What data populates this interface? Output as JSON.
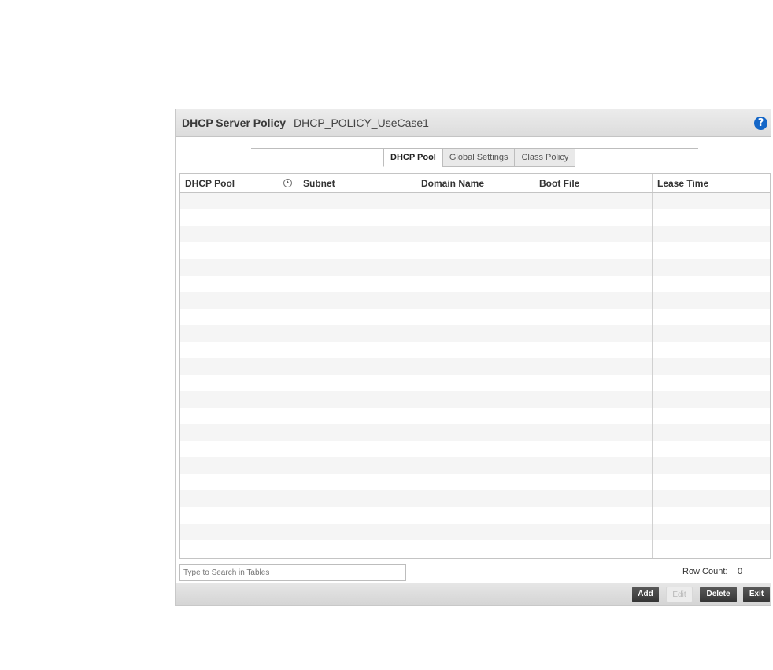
{
  "header": {
    "title": "DHCP Server Policy",
    "policy_name": "DHCP_POLICY_UseCase1",
    "help_icon": "?"
  },
  "tabs": [
    {
      "label": "DHCP Pool",
      "active": true
    },
    {
      "label": "Global Settings",
      "active": false
    },
    {
      "label": "Class Policy",
      "active": false
    }
  ],
  "table": {
    "columns": [
      "DHCP Pool",
      "Subnet",
      "Domain Name",
      "Boot File",
      "Lease Time"
    ],
    "sort_icon": "▲",
    "rows": []
  },
  "search": {
    "placeholder": "Type to Search in Tables"
  },
  "row_count": {
    "label": "Row Count:",
    "value": "0"
  },
  "buttons": {
    "add": "Add",
    "edit": "Edit",
    "delete": "Delete",
    "exit": "Exit"
  },
  "colors": {
    "help": "#1466c7",
    "button": "#3a3a3a"
  }
}
